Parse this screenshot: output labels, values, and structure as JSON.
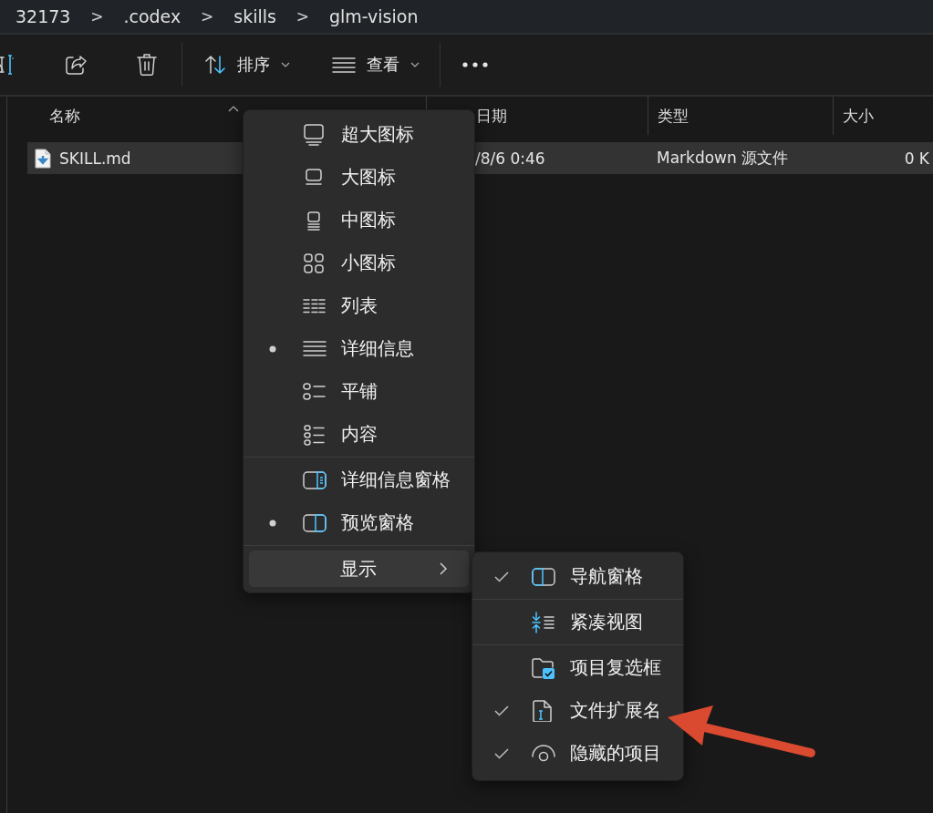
{
  "breadcrumb": [
    {
      "kind": "folder",
      "label": "32173"
    },
    {
      "kind": "separator",
      "label": ">"
    },
    {
      "kind": "folder",
      "label": ".codex"
    },
    {
      "kind": "separator",
      "label": ">"
    },
    {
      "kind": "folder",
      "label": "skills"
    },
    {
      "kind": "separator",
      "label": ">"
    },
    {
      "kind": "folder",
      "label": "glm-vision"
    }
  ],
  "toolbar": {
    "sort_button": {
      "label": "排序"
    },
    "view_button": {
      "label": "查看"
    }
  },
  "file_list": {
    "columns": [
      {
        "label": "名称",
        "sorted": true
      },
      {
        "label": "日期",
        "sorted": false
      },
      {
        "label": "类型",
        "sorted": false
      },
      {
        "label": "大小",
        "sorted": false
      }
    ],
    "rows": [
      {
        "name": "SKILL.md",
        "date": "/8/6 0:46",
        "type": "Markdown 源文件",
        "size": "0 K",
        "selected": true
      }
    ]
  },
  "view_menu": {
    "groups": [
      {
        "items": [
          {
            "kind": "option",
            "label": "超大图标",
            "selected": false
          },
          {
            "kind": "option",
            "label": "大图标",
            "selected": false
          },
          {
            "kind": "option",
            "label": "中图标",
            "selected": false
          },
          {
            "kind": "option",
            "label": "小图标",
            "selected": false
          },
          {
            "kind": "option",
            "label": "列表",
            "selected": false
          },
          {
            "kind": "option",
            "label": "详细信息",
            "selected": true
          },
          {
            "kind": "option",
            "label": "平铺",
            "selected": false
          },
          {
            "kind": "option",
            "label": "内容",
            "selected": false
          }
        ]
      },
      {
        "items": [
          {
            "kind": "option",
            "label": "详细信息窗格",
            "selected": false
          },
          {
            "kind": "option",
            "label": "预览窗格",
            "selected": true
          }
        ]
      },
      {
        "items": [
          {
            "kind": "submenu",
            "label": "显示",
            "expanded": true
          }
        ]
      }
    ]
  },
  "show_submenu": {
    "groups": [
      {
        "items": [
          {
            "kind": "toggle",
            "label": "导航窗格",
            "checked": true
          }
        ]
      },
      {
        "items": [
          {
            "kind": "toggle",
            "label": "紧凑视图",
            "checked": false
          }
        ]
      },
      {
        "items": [
          {
            "kind": "toggle",
            "label": "项目复选框",
            "checked": false
          },
          {
            "kind": "toggle",
            "label": "文件扩展名",
            "checked": true
          },
          {
            "kind": "toggle",
            "label": "隐藏的项目",
            "checked": true
          }
        ]
      }
    ]
  }
}
